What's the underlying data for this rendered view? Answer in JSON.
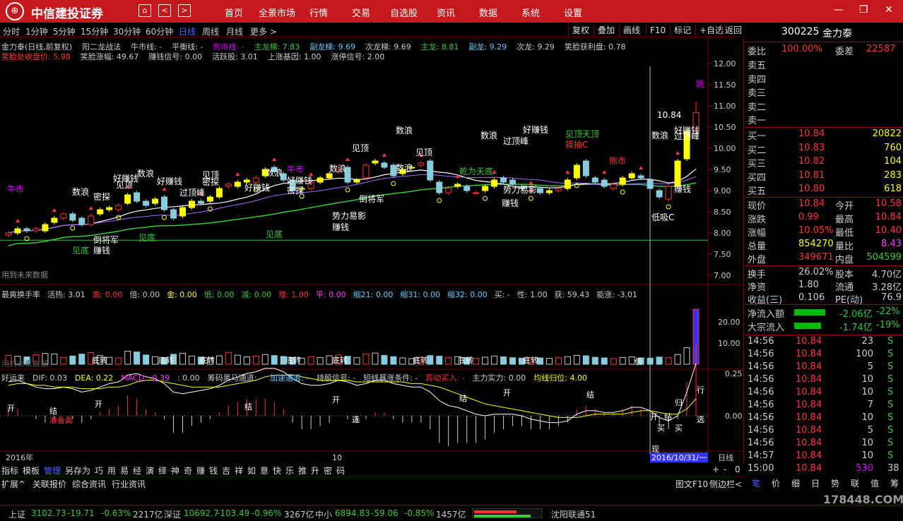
{
  "app": {
    "brand": "中信建投证券",
    "logo_glyph": "⊕",
    "menu": [
      "首页",
      "全景市场",
      "行情",
      "交易",
      "自选股",
      "资讯",
      "数据",
      "系统",
      "设置"
    ]
  },
  "periods": [
    "分时",
    "1分钟",
    "5分钟",
    "15分钟",
    "30分钟",
    "60分钟",
    "日线",
    "周线",
    "月线",
    "更多 >"
  ],
  "toolbar": [
    "复权",
    "叠加",
    "画线",
    "F10",
    "标记",
    "+自选",
    "返回"
  ],
  "chart_info": {
    "line1": [
      {
        "t": "金力泰(日线,前复权)",
        "c": "#ccc"
      },
      {
        "t": "阳二龙战法",
        "c": "#ccc"
      },
      {
        "t": "牛市线: -",
        "c": "#ccc"
      },
      {
        "t": "平衡线: -",
        "c": "#ccc"
      },
      {
        "t": "熊市线: -",
        "c": "#d0f"
      },
      {
        "t": "主龙梯: 7.83",
        "c": "#3c3"
      },
      {
        "t": "副龙梯: 9.69",
        "c": "#6cf"
      },
      {
        "t": "次龙梯: 9.69",
        "c": "#ccc"
      },
      {
        "t": "主龙: 8.81",
        "c": "#3c3"
      },
      {
        "t": "副龙: 9.29",
        "c": "#6cf"
      },
      {
        "t": "次龙: 9.29",
        "c": "#ccc"
      },
      {
        "t": "笑脸获利盘: 0.78",
        "c": "#ccc"
      }
    ],
    "line2": [
      {
        "t": "笑脸处收盘价: 5.98",
        "c": "#f33"
      },
      {
        "t": "笑脸涨幅: 49.67",
        "c": "#ccc"
      },
      {
        "t": "赚钱信号: 0.00",
        "c": "#ccc"
      },
      {
        "t": "活跃股: 3.01",
        "c": "#ccc"
      },
      {
        "t": "上涨基因: 1.00",
        "c": "#ccc"
      },
      {
        "t": "涨停信号: 2.00",
        "c": "#ccc"
      }
    ],
    "future_note": "用到未来数据"
  },
  "price_axis": [
    "12.00",
    "11.50",
    "11.00",
    "10.50",
    "10.00",
    "9.50",
    "9.00",
    "8.50",
    "8.00",
    "7.50",
    "7.00"
  ],
  "chart_labels": [
    {
      "t": "牛市",
      "c": "#d0f"
    },
    {
      "t": "数浪",
      "c": "#fff"
    },
    {
      "t": "密探",
      "c": "#fff"
    },
    {
      "t": "见顶",
      "c": "#fff"
    },
    {
      "t": "好赚钱",
      "c": "#fff"
    },
    {
      "t": "数浪",
      "c": "#fff"
    },
    {
      "t": "好赚钱",
      "c": "#fff"
    },
    {
      "t": "过顶峰",
      "c": "#fff"
    },
    {
      "t": "见顶",
      "c": "#fff"
    },
    {
      "t": "密探",
      "c": "#fff"
    },
    {
      "t": "好赚钱",
      "c": "#fff"
    },
    {
      "t": "数浪",
      "c": "#fff"
    },
    {
      "t": "牛市",
      "c": "#d0f"
    },
    {
      "t": "好赚钱",
      "c": "#fff"
    },
    {
      "t": "密探",
      "c": "#fff"
    },
    {
      "t": "数浪",
      "c": "#fff"
    },
    {
      "t": "见顶",
      "c": "#fff"
    },
    {
      "t": "数浪",
      "c": "#fff"
    },
    {
      "t": "见顶",
      "c": "#fff"
    },
    {
      "t": "数浪",
      "c": "#fff"
    },
    {
      "t": "好赚钱",
      "c": "#fff"
    },
    {
      "t": "过顶峰",
      "c": "#fff"
    },
    {
      "t": "见顶天顶",
      "c": "#3c3"
    },
    {
      "t": "摸抽C",
      "c": "#f33"
    },
    {
      "t": "乾为天底",
      "c": "#3c3"
    },
    {
      "t": "熊市",
      "c": "#f33"
    },
    {
      "t": "势力易影",
      "c": "#fff"
    },
    {
      "t": "势力易影",
      "c": "#fff"
    },
    {
      "t": "赚钱",
      "c": "#fff"
    },
    {
      "t": "数浪",
      "c": "#fff"
    },
    {
      "t": "好赚钱",
      "c": "#fff"
    },
    {
      "t": "过顶峰",
      "c": "#fff"
    },
    {
      "t": "跳",
      "c": "#d0f"
    },
    {
      "t": "赚钱",
      "c": "#fff"
    },
    {
      "t": "低吸C",
      "c": "#fff"
    },
    {
      "t": "见底",
      "c": "#3c3"
    },
    {
      "t": "见底",
      "c": "#3c3"
    },
    {
      "t": "见底",
      "c": "#3c3"
    },
    {
      "t": "赚钱",
      "c": "#fff"
    },
    {
      "t": "赚钱",
      "c": "#fff"
    },
    {
      "t": "倒将军",
      "c": "#fff"
    },
    {
      "t": "倒将军",
      "c": "#fff"
    },
    {
      "t": "10.84",
      "c": "#fff"
    },
    {
      "t": "数浪",
      "c": "#fff"
    }
  ],
  "turnover_info": [
    {
      "t": "最爽换手率",
      "c": "#ccc"
    },
    {
      "t": "活热: 3.01",
      "c": "#ccc"
    },
    {
      "t": "高: 0.00",
      "c": "#f33"
    },
    {
      "t": "倍: 0.00",
      "c": "#ccc"
    },
    {
      "t": "金: 0.00",
      "c": "#ff0"
    },
    {
      "t": "低: 0.00",
      "c": "#3c3"
    },
    {
      "t": "减: 0.00",
      "c": "#3c3"
    },
    {
      "t": "增: 1.00",
      "c": "#f33"
    },
    {
      "t": "平: 0.00",
      "c": "#f3f"
    },
    {
      "t": "缩21: 0.00",
      "c": "#6cf"
    },
    {
      "t": "缩31: 0.00",
      "c": "#6cf"
    },
    {
      "t": "缩32: 0.00",
      "c": "#6cf"
    },
    {
      "t": "买: -",
      "c": "#ccc"
    },
    {
      "t": "性: 1.00",
      "c": "#ccc"
    },
    {
      "t": "获: 59.43",
      "c": "#ccc"
    },
    {
      "t": "能涨: -3.01",
      "c": "#ccc"
    }
  ],
  "turnover_axis": [
    "20.00",
    "10.00"
  ],
  "turnover_labels": [
    "底转",
    "底转",
    "底转",
    "底转",
    "底转",
    "底转",
    "底转",
    "底转",
    "低",
    "用到未来数据"
  ],
  "macd_info": [
    {
      "t": "好运来",
      "c": "#ccc"
    },
    {
      "t": "DIF: 0.03",
      "c": "#ccc"
    },
    {
      "t": "DEA: 0.22",
      "c": "#ff0"
    },
    {
      "t": "MACD: -0.39",
      "c": "#f3f"
    },
    {
      "t": ": 0.00",
      "c": "#ccc"
    },
    {
      "t": "筹码黑马通道: -",
      "c": "#ccc"
    },
    {
      "t": "加速通道: -",
      "c": "#6cf"
    },
    {
      "t": "持股信号: -",
      "c": "#ccc"
    },
    {
      "t": "短线暴涨条件: -",
      "c": "#ccc"
    },
    {
      "t": "异动买入: -",
      "c": "#f33"
    },
    {
      "t": "主力实力: 0.00",
      "c": "#ccc"
    },
    {
      "t": "均线归位: 4.00",
      "c": "#ff0"
    }
  ],
  "macd_axis": [
    "0.25",
    "0.00"
  ],
  "macd_labels": [
    "开",
    "结",
    "开",
    "结",
    "开",
    "结",
    "开",
    "结",
    "开",
    "结",
    "归",
    "行",
    "选",
    "选",
    "买",
    "买",
    "准备离",
    "现"
  ],
  "time_axis": {
    "year": "2016年",
    "month": "10",
    "cursor_date": "2016/10/31/一",
    "period": "日线"
  },
  "bottom_tabs": [
    "指标",
    "模板",
    "管理",
    "另存为",
    "巧",
    "用",
    "易",
    "经",
    "演",
    "绎",
    "神",
    "奇",
    "赚",
    "钱",
    "吉",
    "祥",
    "如",
    "意",
    "快",
    "乐",
    "推",
    "升",
    "密",
    "码"
  ],
  "ext_bar": [
    "扩展^",
    "关联报价",
    "综合资讯",
    "行业资讯"
  ],
  "ext_right": [
    "图文F10",
    "侧边栏<"
  ],
  "scroll_btns": [
    "+",
    "-",
    "0"
  ],
  "quote": {
    "code": "300225",
    "name": "金力泰",
    "weibi_label": "委比",
    "weibi": "100.00%",
    "weicha_label": "委差",
    "weicha": "22587",
    "asks": [
      {
        "label": "卖五",
        "price": "",
        "vol": ""
      },
      {
        "label": "卖四",
        "price": "",
        "vol": ""
      },
      {
        "label": "卖三",
        "price": "",
        "vol": ""
      },
      {
        "label": "卖二",
        "price": "",
        "vol": ""
      },
      {
        "label": "卖一",
        "price": "",
        "vol": ""
      }
    ],
    "bids": [
      {
        "label": "买一",
        "price": "10.84",
        "vol": "20822"
      },
      {
        "label": "买二",
        "price": "10.83",
        "vol": "760"
      },
      {
        "label": "买三",
        "price": "10.82",
        "vol": "104"
      },
      {
        "label": "买四",
        "price": "10.81",
        "vol": "283"
      },
      {
        "label": "买五",
        "price": "10.80",
        "vol": "618"
      }
    ],
    "stats": [
      {
        "l1": "现价",
        "v1": "10.84",
        "c1": "#f33",
        "l2": "今开",
        "v2": "10.58",
        "c2": "#f33"
      },
      {
        "l1": "涨跌",
        "v1": "0.99",
        "c1": "#f33",
        "l2": "最高",
        "v2": "10.84",
        "c2": "#f33"
      },
      {
        "l1": "涨幅",
        "v1": "10.05%",
        "c1": "#f33",
        "l2": "最低",
        "v2": "10.40",
        "c2": "#f33"
      },
      {
        "l1": "总量",
        "v1": "854270",
        "c1": "#ff0",
        "l2": "量比",
        "v2": "8.43",
        "c2": "#f3f"
      },
      {
        "l1": "外盘",
        "v1": "349671",
        "c1": "#f33",
        "l2": "内盘",
        "v2": "504599",
        "c2": "#3c3"
      }
    ],
    "stats2": [
      {
        "l1": "换手",
        "v1": "26.02%",
        "c1": "#ccc",
        "l2": "股本",
        "v2": "4.70亿",
        "c2": "#ccc"
      },
      {
        "l1": "净资",
        "v1": "1.80",
        "c1": "#ccc",
        "l2": "流通",
        "v2": "3.28亿",
        "c2": "#ccc"
      },
      {
        "l1": "收益(三)",
        "v1": "0.106",
        "c1": "#ccc",
        "l2": "PE(动)",
        "v2": "76.9",
        "c2": "#ccc"
      }
    ],
    "flows": [
      {
        "label": "净流入额",
        "value": "-2.06亿",
        "pct": "-22%"
      },
      {
        "label": "大宗流入",
        "value": "-1.74亿",
        "pct": "-19%"
      }
    ],
    "ticks": [
      {
        "time": "14:56",
        "price": "10.84",
        "vol": "23",
        "side": "S",
        "vc": "#ccc"
      },
      {
        "time": "14:56",
        "price": "10.84",
        "vol": "100",
        "side": "S",
        "vc": "#ccc"
      },
      {
        "time": "14:56",
        "price": "10.84",
        "vol": "5",
        "side": "S",
        "vc": "#ccc"
      },
      {
        "time": "14:56",
        "price": "10.84",
        "vol": "10",
        "side": "S",
        "vc": "#ccc"
      },
      {
        "time": "14:56",
        "price": "10.84",
        "vol": "10",
        "side": "S",
        "vc": "#ccc"
      },
      {
        "time": "14:56",
        "price": "10.84",
        "vol": "7",
        "side": "S",
        "vc": "#ccc"
      },
      {
        "time": "14:56",
        "price": "10.84",
        "vol": "10",
        "side": "S",
        "vc": "#ccc"
      },
      {
        "time": "14:56",
        "price": "10.84",
        "vol": "5",
        "side": "S",
        "vc": "#ccc"
      },
      {
        "time": "14:56",
        "price": "10.84",
        "vol": "10",
        "side": "S",
        "vc": "#ccc"
      },
      {
        "time": "14:57",
        "price": "10.84",
        "vol": "10",
        "side": "S",
        "vc": "#ccc"
      },
      {
        "time": "15:00",
        "price": "10.84",
        "vol": "530",
        "side": "38",
        "vc": "#d0f"
      }
    ],
    "tabs": [
      "笔",
      "价",
      "细",
      "日",
      "势",
      "联",
      "值",
      "筹"
    ]
  },
  "status": [
    {
      "t": "上证",
      "c": "#ccc"
    },
    {
      "t": "3102.73",
      "c": "#3c3"
    },
    {
      "t": "-19.71",
      "c": "#3c3"
    },
    {
      "t": "-0.63%",
      "c": "#3c3"
    },
    {
      "t": "2217亿",
      "c": "#ccc"
    },
    {
      "t": "深证",
      "c": "#ccc"
    },
    {
      "t": "10692.7",
      "c": "#3c3"
    },
    {
      "t": "-103.49",
      "c": "#3c3"
    },
    {
      "t": "-0.96%",
      "c": "#3c3"
    },
    {
      "t": "3267亿",
      "c": "#ccc"
    },
    {
      "t": "中小",
      "c": "#ccc"
    },
    {
      "t": "6894.83",
      "c": "#3c3"
    },
    {
      "t": "-59.06",
      "c": "#3c3"
    },
    {
      "t": "-0.85%",
      "c": "#3c3"
    },
    {
      "t": "1457亿",
      "c": "#ccc"
    },
    {
      "t": "沈阳联通51",
      "c": "#ccc"
    }
  ],
  "watermark": "178448.COM",
  "candles": {
    "o": [
      7.95,
      8.0,
      8.1,
      8.05,
      8.05,
      8.25,
      8.35,
      8.45,
      8.35,
      8.2,
      8.45,
      8.55,
      8.55,
      8.7,
      8.95,
      8.75,
      8.7,
      8.85,
      8.55,
      8.4,
      8.6,
      8.75,
      8.75,
      8.85,
      9.1,
      9.1,
      9.2,
      9.2,
      9.35,
      9.55,
      9.4,
      9.25,
      9.05,
      9.05,
      9.2,
      9.3,
      9.45,
      9.55,
      9.2,
      9.3,
      9.65,
      9.65,
      9.6,
      9.4,
      9.55,
      9.6,
      9.7,
      9.2,
      8.95,
      9.1,
      9.1,
      8.95,
      9.0,
      9.1,
      9.3,
      9.25,
      9.1,
      9.0,
      9.05,
      8.95,
      9.0,
      9.05,
      9.3,
      9.7,
      9.3,
      9.25,
      9.05,
      9.15,
      9.3,
      9.35,
      9.25,
      9.0,
      8.8,
      9.1,
      9.75,
      10.4
    ],
    "c": [
      8.0,
      8.1,
      8.05,
      8.1,
      8.2,
      8.35,
      8.45,
      8.3,
      8.2,
      8.4,
      8.55,
      8.6,
      8.65,
      8.9,
      8.75,
      8.65,
      8.8,
      8.55,
      8.35,
      8.6,
      8.75,
      8.7,
      8.85,
      9.05,
      9.15,
      9.2,
      9.25,
      9.3,
      9.5,
      9.45,
      9.25,
      9.0,
      9.05,
      9.2,
      9.3,
      9.4,
      9.5,
      9.2,
      9.25,
      9.6,
      9.7,
      9.55,
      9.35,
      9.5,
      9.55,
      9.65,
      9.25,
      8.95,
      9.05,
      9.15,
      9.0,
      8.95,
      9.1,
      9.25,
      9.2,
      9.15,
      9.05,
      9.0,
      8.95,
      9.0,
      9.05,
      9.25,
      9.6,
      9.35,
      9.2,
      9.1,
      9.15,
      9.3,
      9.4,
      9.3,
      9.05,
      8.85,
      9.1,
      9.7,
      10.4,
      10.84
    ],
    "h": [
      8.05,
      8.15,
      8.15,
      8.15,
      8.25,
      8.4,
      8.5,
      8.5,
      8.4,
      8.45,
      8.6,
      8.65,
      8.7,
      8.95,
      9.0,
      8.8,
      8.85,
      8.9,
      8.6,
      8.65,
      8.8,
      8.8,
      8.9,
      9.1,
      9.2,
      9.25,
      9.3,
      9.35,
      9.55,
      9.6,
      9.45,
      9.3,
      9.1,
      9.25,
      9.35,
      9.45,
      9.55,
      9.6,
      9.3,
      9.65,
      9.75,
      9.7,
      9.65,
      9.55,
      9.6,
      9.7,
      9.75,
      9.25,
      9.1,
      9.2,
      9.15,
      9.0,
      9.15,
      9.3,
      9.35,
      9.3,
      9.15,
      9.05,
      9.1,
      9.05,
      9.1,
      9.3,
      9.65,
      9.75,
      9.35,
      9.3,
      9.2,
      9.35,
      9.45,
      9.4,
      9.3,
      9.05,
      9.15,
      9.75,
      10.45,
      11.1
    ],
    "l": [
      7.9,
      7.95,
      8.0,
      8.0,
      8.0,
      8.2,
      8.3,
      8.25,
      8.15,
      8.15,
      8.4,
      8.5,
      8.5,
      8.65,
      8.7,
      8.6,
      8.65,
      8.5,
      8.3,
      8.35,
      8.55,
      8.65,
      8.7,
      8.8,
      9.05,
      9.05,
      9.15,
      9.15,
      9.3,
      9.4,
      9.2,
      8.95,
      9.0,
      9.0,
      9.15,
      9.25,
      9.4,
      9.15,
      9.15,
      9.25,
      9.6,
      9.5,
      9.3,
      9.35,
      9.5,
      9.55,
      9.2,
      8.9,
      8.9,
      9.05,
      8.95,
      8.9,
      8.95,
      9.05,
      9.15,
      9.1,
      9.0,
      8.95,
      8.9,
      8.9,
      8.95,
      9.0,
      9.25,
      9.3,
      9.15,
      9.05,
      9.0,
      9.1,
      9.25,
      9.25,
      9.0,
      8.8,
      8.75,
      9.05,
      9.7,
      10.35
    ],
    "vol": [
      4.2,
      3.8,
      3.5,
      4.5,
      5.1,
      4.9,
      3.2,
      3.9,
      4.8,
      5.5,
      4.1,
      3.3,
      3.0,
      6.2,
      5.8,
      4.4,
      3.6,
      3.1,
      4.7,
      5.2,
      3.9,
      3.4,
      2.8,
      4.0,
      5.6,
      4.3,
      3.5,
      3.9,
      4.6,
      4.1,
      3.7,
      3.3,
      2.9,
      3.6,
      3.2,
      4.0,
      4.4,
      3.8,
      3.1,
      4.9,
      5.3,
      4.2,
      3.6,
      3.0,
      2.7,
      3.3,
      4.1,
      3.8,
      3.2,
      3.6,
      3.0,
      2.8,
      3.3,
      3.9,
      3.5,
      3.1,
      2.9,
      2.6,
      3.0,
      2.8,
      3.1,
      3.6,
      4.2,
      4.0,
      3.3,
      3.0,
      2.7,
      3.2,
      3.5,
      3.0,
      2.9,
      3.4,
      3.1,
      4.6,
      7.8,
      26.0
    ],
    "dif": [
      0.2,
      0.21,
      0.19,
      0.17,
      0.16,
      0.16,
      0.17,
      0.16,
      0.14,
      0.15,
      0.17,
      0.19,
      0.2,
      0.24,
      0.25,
      0.23,
      0.22,
      0.19,
      0.14,
      0.13,
      0.14,
      0.15,
      0.16,
      0.18,
      0.21,
      0.23,
      0.25,
      0.26,
      0.28,
      0.28,
      0.26,
      0.22,
      0.19,
      0.18,
      0.18,
      0.19,
      0.21,
      0.2,
      0.18,
      0.19,
      0.21,
      0.21,
      0.19,
      0.18,
      0.17,
      0.17,
      0.14,
      0.09,
      0.06,
      0.05,
      0.03,
      0.01,
      0.0,
      0.01,
      0.01,
      0.01,
      0.0,
      -0.02,
      -0.03,
      -0.04,
      -0.04,
      -0.03,
      0.01,
      0.03,
      0.03,
      0.02,
      0.02,
      0.03,
      0.05,
      0.05,
      0.03,
      -0.01,
      -0.03,
      0.0,
      0.14,
      0.31
    ],
    "dea": [
      0.18,
      0.19,
      0.19,
      0.18,
      0.18,
      0.17,
      0.17,
      0.17,
      0.16,
      0.16,
      0.16,
      0.17,
      0.17,
      0.18,
      0.2,
      0.21,
      0.21,
      0.2,
      0.19,
      0.18,
      0.17,
      0.17,
      0.17,
      0.17,
      0.18,
      0.19,
      0.2,
      0.21,
      0.23,
      0.24,
      0.24,
      0.24,
      0.23,
      0.22,
      0.21,
      0.21,
      0.21,
      0.21,
      0.2,
      0.2,
      0.2,
      0.2,
      0.2,
      0.2,
      0.19,
      0.19,
      0.18,
      0.17,
      0.15,
      0.13,
      0.11,
      0.09,
      0.07,
      0.06,
      0.05,
      0.04,
      0.03,
      0.02,
      0.01,
      0.0,
      -0.01,
      -0.01,
      -0.01,
      0.0,
      0.01,
      0.01,
      0.01,
      0.01,
      0.02,
      0.03,
      0.03,
      0.02,
      0.01,
      0.01,
      0.04,
      0.1
    ],
    "macd": [
      0.04,
      0.04,
      0.0,
      -0.02,
      -0.04,
      -0.02,
      0.0,
      -0.02,
      -0.04,
      -0.02,
      0.02,
      0.04,
      0.06,
      0.12,
      0.1,
      0.04,
      0.02,
      -0.02,
      -0.1,
      -0.1,
      -0.06,
      -0.04,
      -0.02,
      0.02,
      0.06,
      0.08,
      0.1,
      0.1,
      0.1,
      0.08,
      0.04,
      -0.04,
      -0.08,
      -0.08,
      -0.06,
      -0.04,
      0.0,
      -0.02,
      -0.04,
      -0.02,
      0.02,
      0.02,
      -0.02,
      -0.04,
      -0.04,
      -0.04,
      -0.08,
      -0.16,
      -0.18,
      -0.16,
      -0.16,
      -0.16,
      -0.14,
      -0.1,
      -0.08,
      -0.06,
      -0.06,
      -0.08,
      -0.08,
      -0.08,
      -0.06,
      -0.04,
      0.04,
      0.06,
      0.04,
      0.02,
      0.02,
      0.04,
      0.06,
      0.04,
      0.0,
      -0.06,
      -0.08,
      -0.02,
      0.2,
      0.42
    ]
  }
}
